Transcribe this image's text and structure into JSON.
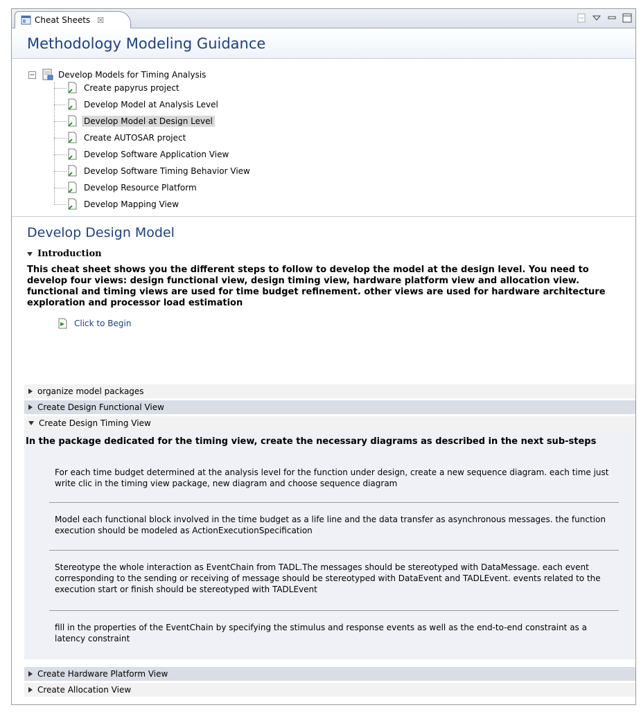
{
  "tab": {
    "label": "Cheat Sheets",
    "close_glyph": "☒"
  },
  "page_title": "Methodology Modeling Guidance",
  "tree": {
    "root_label": "Develop Models for Timing Analysis",
    "collapse_glyph": "−",
    "items": [
      {
        "label": "Create papyrus project",
        "selected": false
      },
      {
        "label": "Develop Model at Analysis Level",
        "selected": false
      },
      {
        "label": "Develop Model at Design Level",
        "selected": true
      },
      {
        "label": "Create AUTOSAR project",
        "selected": false
      },
      {
        "label": "Develop Software Application View",
        "selected": false
      },
      {
        "label": "Develop Software Timing Behavior View",
        "selected": false
      },
      {
        "label": "Develop Resource Platform",
        "selected": false
      },
      {
        "label": "Develop Mapping View",
        "selected": false
      }
    ]
  },
  "detail": {
    "title": "Develop Design Model",
    "intro_heading": "Introduction",
    "intro_text": "This cheat sheet shows you the different steps to follow to develop the model at the design level. You need to develop four views: design functional view, design timing view, hardware platform view and allocation view. functional and timing views are used for time budget refinement. other views are used for hardware architecture exploration and processor load estimation",
    "begin_label": "Click to Begin",
    "steps": [
      {
        "label": "organize model packages",
        "expanded": false
      },
      {
        "label": "Create Design Functional View",
        "expanded": false
      },
      {
        "label": "Create Design Timing View",
        "expanded": true
      },
      {
        "label": "Create Hardware Platform View",
        "expanded": false
      },
      {
        "label": "Create Allocation View",
        "expanded": false
      }
    ],
    "timing_text": "In the package dedicated for the timing view, create the necessary diagrams as described in the next sub-steps",
    "sub_steps": [
      "For each time budget determined at the analysis level for the function under design, create a new sequence diagram. each time just write clic in the timing view package, new diagram and choose sequence diagram",
      "Model each functional block involved in the time budget as a life line and the data transfer as asynchronous messages. the function execution should be modeled as ActionExecutionSpecification",
      "Stereotype the whole interaction as EventChain from TADL.The messages should be stereotyped with DataMessage. each event corresponding to the sending or receiving of message should be stereotyped with DataEvent and TADLEvent. events related to the execution start or finish should be stereotyped with TADLEvent",
      "fill in the properties of the EventChain by specifying the stimulus and response events as well as the end-to-end constraint as a latency constraint"
    ]
  },
  "colors": {
    "title": "#20427a",
    "link": "#1d3f8a",
    "selected_bg": "#d8d8d8"
  }
}
